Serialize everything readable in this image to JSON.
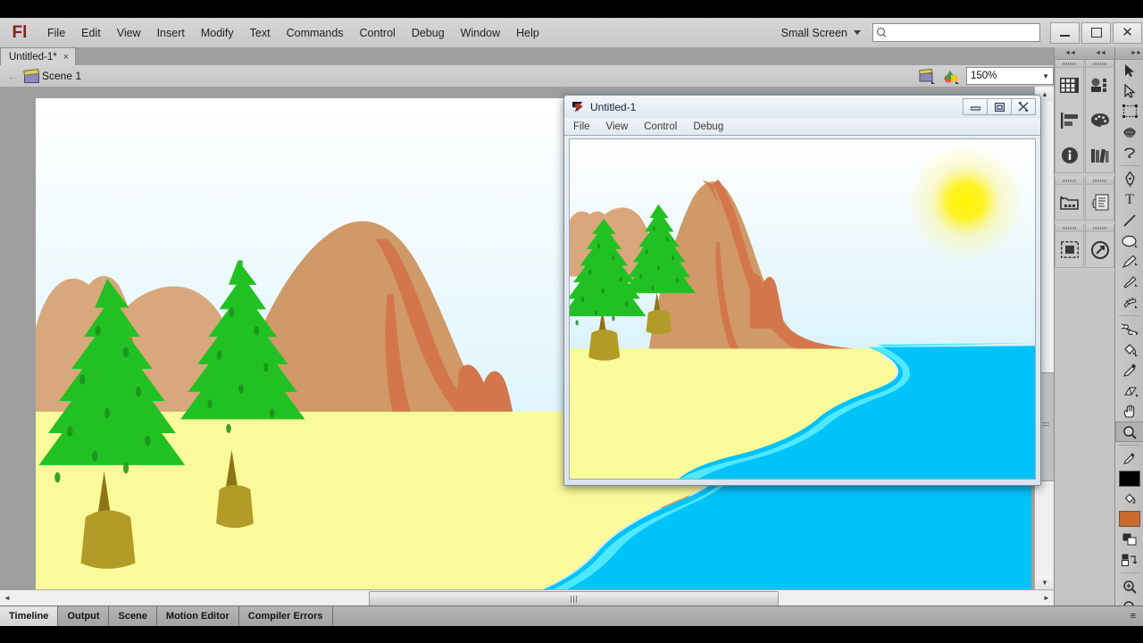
{
  "app": {
    "name": "Adobe Flash Professional",
    "logo_text": "Fl",
    "menu": [
      "File",
      "Edit",
      "View",
      "Insert",
      "Modify",
      "Text",
      "Commands",
      "Control",
      "Debug",
      "Window",
      "Help"
    ],
    "workspace_switcher": {
      "label": "Small Screen",
      "icon": "chevron-down-icon"
    },
    "search": {
      "value": "",
      "placeholder": "",
      "icon": "search-icon"
    },
    "window_controls": {
      "minimize": "minimize-icon",
      "maximize": "maximize-icon",
      "close": "close-icon"
    }
  },
  "document_tabs": [
    {
      "label": "Untitled-1*",
      "close": "×",
      "active": true
    }
  ],
  "scene_bar": {
    "back_arrow": "←",
    "scene_icon": "clapboard-icon",
    "scene_label": "Scene 1",
    "edit_scene_icon": "edit-scene-icon",
    "edit_symbols_icon": "edit-symbols-icon",
    "zoom": {
      "value": "150%",
      "caret": "▼"
    }
  },
  "right_dock": {
    "header": {
      "collapse_left": "◄◄",
      "collapse_right": "◄◄"
    },
    "column_a": [
      {
        "name": "properties-panel-icon",
        "glyph": "grid"
      },
      {
        "name": "align-panel-icon",
        "glyph": "align"
      },
      {
        "name": "info-panel-icon",
        "glyph": "info"
      },
      {
        "name": "library-panel-icon",
        "glyph": "folder"
      },
      {
        "name": "movie-explorer-icon",
        "glyph": "frame"
      }
    ],
    "column_b": [
      {
        "name": "color-panel-icon",
        "glyph": "swatchbox"
      },
      {
        "name": "swatches-panel-icon",
        "glyph": "palette"
      },
      {
        "name": "components-panel-icon",
        "glyph": "books"
      },
      {
        "name": "actions-panel-icon",
        "glyph": "code"
      },
      {
        "name": "behaviors-panel-icon",
        "glyph": "arrow-circle"
      }
    ]
  },
  "tools_panel": {
    "collapse": "►►",
    "tools": [
      {
        "name": "selection-tool",
        "glyph": "➤",
        "selected": false
      },
      {
        "name": "subselection-tool",
        "glyph": "➤",
        "selected": false
      },
      {
        "name": "free-transform-tool",
        "glyph": "⬚",
        "selected": false
      },
      {
        "name": "3d-rotation-tool",
        "glyph": "●",
        "selected": false
      },
      {
        "name": "lasso-tool",
        "glyph": "◔",
        "selected": false
      },
      {
        "name": "pen-tool",
        "glyph": "✒",
        "selected": false
      },
      {
        "name": "text-tool",
        "glyph": "T",
        "selected": false
      },
      {
        "name": "line-tool",
        "glyph": "╱",
        "selected": false
      },
      {
        "name": "oval-tool",
        "glyph": "●",
        "selected": false
      },
      {
        "name": "pencil-tool",
        "glyph": "✎",
        "selected": false
      },
      {
        "name": "brush-tool",
        "glyph": "✐",
        "selected": false
      },
      {
        "name": "deco-tool",
        "glyph": "❄",
        "selected": false
      },
      {
        "name": "bone-tool",
        "glyph": "☠",
        "selected": false
      },
      {
        "name": "paint-bucket-tool",
        "glyph": "◢",
        "selected": false
      },
      {
        "name": "eyedropper-tool",
        "glyph": "✒",
        "selected": false
      },
      {
        "name": "eraser-tool",
        "glyph": "▱",
        "selected": false
      },
      {
        "name": "hand-tool",
        "glyph": "✋",
        "selected": false
      },
      {
        "name": "zoom-tool",
        "glyph": "⚲",
        "selected": true
      }
    ],
    "colors": {
      "stroke_color_label": "stroke-color-swatch",
      "stroke_color": "#000000",
      "fill_color_label": "fill-color-swatch",
      "fill_color": "#C96A2E",
      "black-white-icon": "black-and-white-reset",
      "swap-icon": "swap-colors"
    },
    "options": [
      {
        "name": "zoom-in-option",
        "glyph": "⊕"
      },
      {
        "name": "zoom-out-option",
        "glyph": "⊖"
      }
    ]
  },
  "bottom_tabs": [
    {
      "label": "Timeline",
      "active": true
    },
    {
      "label": "Output",
      "active": false
    },
    {
      "label": "Scene",
      "active": false
    },
    {
      "label": "Motion Editor",
      "active": false
    },
    {
      "label": "Compiler Errors",
      "active": false
    }
  ],
  "bottom_panel_menu": "≡",
  "preview_window": {
    "title": "Untitled-1",
    "app_icon": "flash-player-icon",
    "menu": [
      "File",
      "View",
      "Control",
      "Debug"
    ],
    "controls": {
      "minimize": "minimize-icon",
      "restore": "restore-icon",
      "close": "close-icon"
    }
  },
  "artwork": {
    "name": "beach-mountain-scene",
    "colors": {
      "sky_top": "#FFFFFF",
      "sky_bottom": "#BDE8F7",
      "sun": "#FFF200",
      "sun_glow": "#FBF38A",
      "sand": "#FAFA9A",
      "water": "#00C3FA",
      "water_edge": "#4FE8FF",
      "mountain": "#CF9A67",
      "mountain_shade": "#D4764B",
      "mountain_light": "#D8A87C",
      "tree_green": "#22C123",
      "tree_green_dark": "#129012",
      "trunk": "#B39B28",
      "trunk_dark": "#8C7516"
    }
  },
  "scrollbars": {
    "vertical": {
      "up": "▲",
      "down": "▼"
    },
    "horizontal": {
      "left": "◄",
      "right": "►",
      "grip": "‖"
    }
  }
}
